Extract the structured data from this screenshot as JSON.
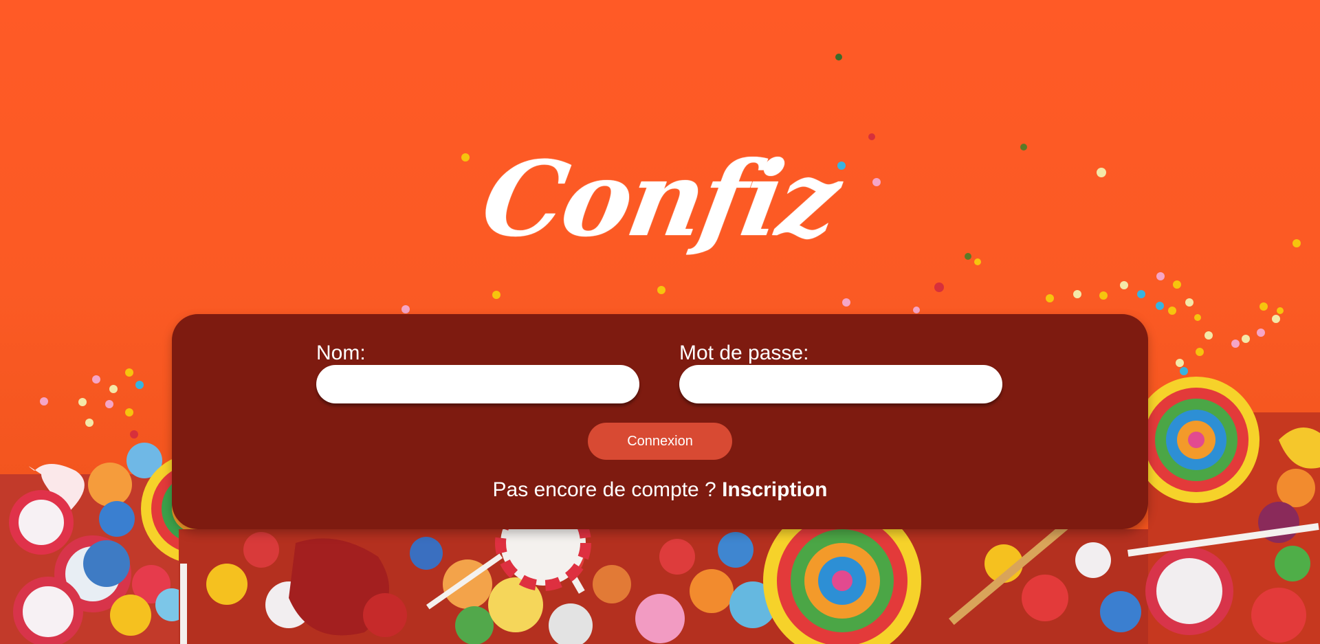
{
  "app": {
    "logo_text": "Confiz"
  },
  "form": {
    "name_label": "Nom:",
    "name_value": "",
    "password_label": "Mot de passe:",
    "password_value": "",
    "submit_label": "Connexion",
    "signup_prompt": "Pas encore de compte ?",
    "signup_link": "Inscription"
  },
  "colors": {
    "background": "#ff5a26",
    "panel": "#7e1b10",
    "button": "#d84a33",
    "text": "#ffffff"
  }
}
